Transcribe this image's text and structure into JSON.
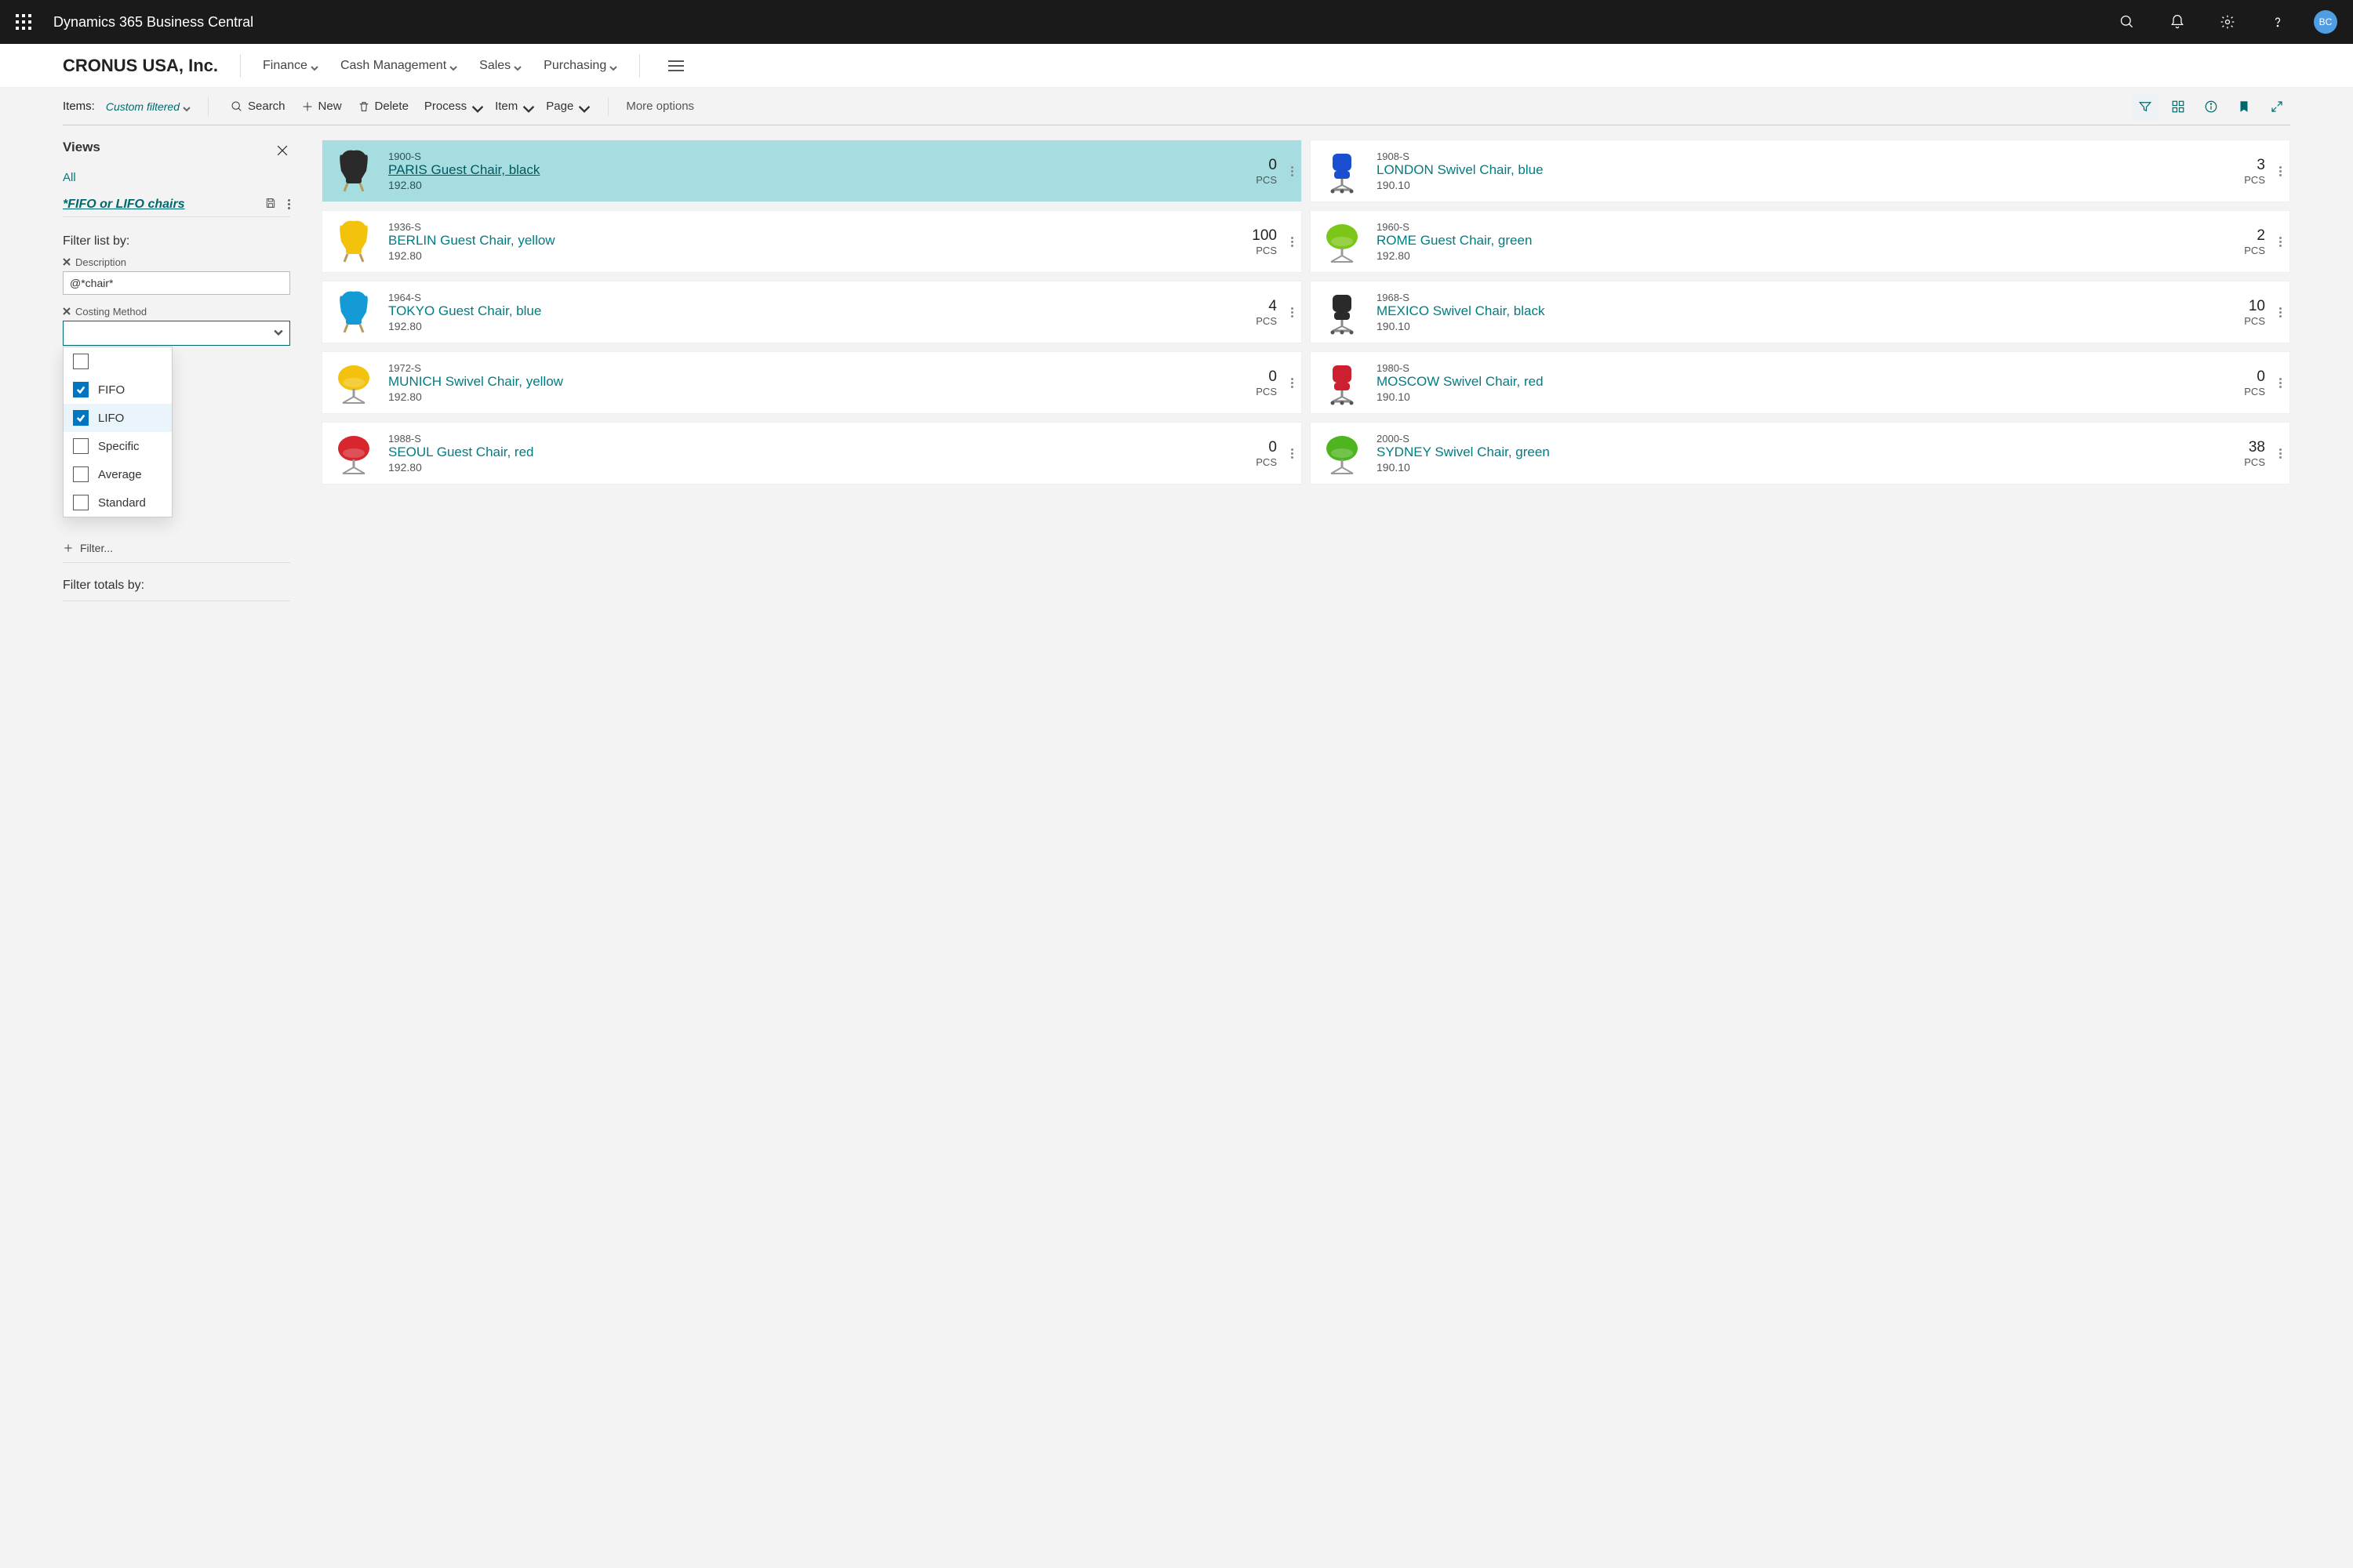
{
  "header": {
    "app_title": "Dynamics 365 Business Central",
    "avatar_initials": "BC"
  },
  "company_bar": {
    "company": "CRONUS USA, Inc.",
    "nav": [
      "Finance",
      "Cash Management",
      "Sales",
      "Purchasing"
    ]
  },
  "action_bar": {
    "items_label": "Items:",
    "view_name": "Custom filtered",
    "search": "Search",
    "new": "New",
    "delete": "Delete",
    "process": "Process",
    "item": "Item",
    "page": "Page",
    "more": "More options"
  },
  "sidebar": {
    "views_title": "Views",
    "all_label": "All",
    "saved_view": "*FIFO or LIFO chairs",
    "filter_title": "Filter list by:",
    "filters": {
      "description_label": "Description",
      "description_value": "@*chair*",
      "costing_label": "Costing Method",
      "costing_value": ""
    },
    "dropdown_options": [
      {
        "label": "",
        "checked": false
      },
      {
        "label": "FIFO",
        "checked": true
      },
      {
        "label": "LIFO",
        "checked": true
      },
      {
        "label": "Specific",
        "checked": false
      },
      {
        "label": "Average",
        "checked": false
      },
      {
        "label": "Standard",
        "checked": false
      }
    ],
    "add_filter": "Filter...",
    "total_by": "Filter totals by:"
  },
  "cards": [
    {
      "sku": "1900-S",
      "name": "PARIS Guest Chair, black",
      "price": "192.80",
      "qty": "0",
      "unit": "PCS",
      "selected": true,
      "color": "#2a2a2a",
      "shape": "wing"
    },
    {
      "sku": "1908-S",
      "name": "LONDON Swivel Chair, blue",
      "price": "190.10",
      "qty": "3",
      "unit": "PCS",
      "selected": false,
      "color": "#1a4fd1",
      "shape": "office"
    },
    {
      "sku": "1936-S",
      "name": "BERLIN Guest Chair, yellow",
      "price": "192.80",
      "qty": "100",
      "unit": "PCS",
      "selected": false,
      "color": "#f2c20c",
      "shape": "wing"
    },
    {
      "sku": "1960-S",
      "name": "ROME Guest Chair, green",
      "price": "192.80",
      "qty": "2",
      "unit": "PCS",
      "selected": false,
      "color": "#7cc61a",
      "shape": "round"
    },
    {
      "sku": "1964-S",
      "name": "TOKYO Guest Chair, blue",
      "price": "192.80",
      "qty": "4",
      "unit": "PCS",
      "selected": false,
      "color": "#149bd6",
      "shape": "wing"
    },
    {
      "sku": "1968-S",
      "name": "MEXICO Swivel Chair, black",
      "price": "190.10",
      "qty": "10",
      "unit": "PCS",
      "selected": false,
      "color": "#2a2a2a",
      "shape": "office"
    },
    {
      "sku": "1972-S",
      "name": "MUNICH Swivel Chair, yellow",
      "price": "192.80",
      "qty": "0",
      "unit": "PCS",
      "selected": false,
      "color": "#f2c20c",
      "shape": "round"
    },
    {
      "sku": "1980-S",
      "name": "MOSCOW Swivel Chair, red",
      "price": "190.10",
      "qty": "0",
      "unit": "PCS",
      "selected": false,
      "color": "#cc1f2f",
      "shape": "office"
    },
    {
      "sku": "1988-S",
      "name": "SEOUL Guest Chair, red",
      "price": "192.80",
      "qty": "0",
      "unit": "PCS",
      "selected": false,
      "color": "#d7262e",
      "shape": "round"
    },
    {
      "sku": "2000-S",
      "name": "SYDNEY Swivel Chair, green",
      "price": "190.10",
      "qty": "38",
      "unit": "PCS",
      "selected": false,
      "color": "#4fb51e",
      "shape": "round"
    }
  ]
}
